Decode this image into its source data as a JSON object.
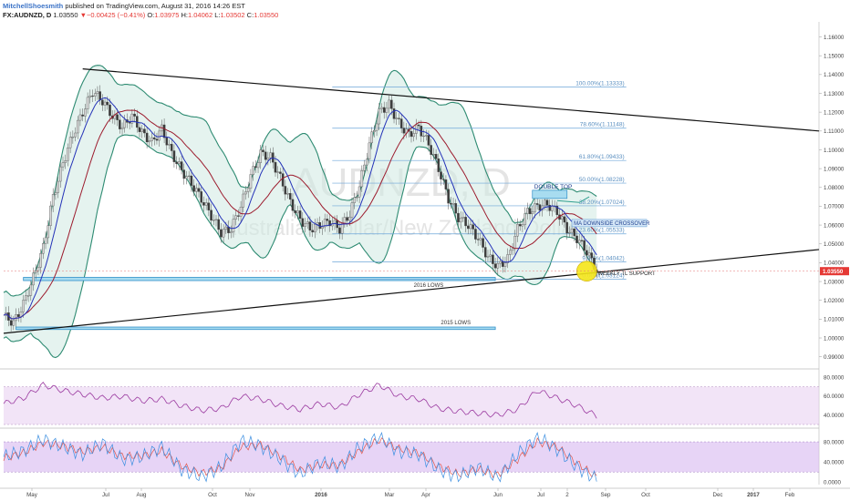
{
  "header": {
    "author": "MitchellShoesmith",
    "published": " published on TradingView.com, August 31, 2016 14:26 EST",
    "symbol": "FX:AUDNZD, D",
    "last": " 1.03550 ",
    "arrow": "▼",
    "change": "−0.00425 (−0.41%)",
    "o_label": " O:",
    "o_val": "1.03975",
    "h_label": " H:",
    "h_val": "1.04062",
    "l_label": " L:",
    "l_val": "1.03502",
    "c_label": " C:",
    "c_val": "1.03550"
  },
  "watermark": {
    "symbol": "AUDNZD, D",
    "name": "Australian Dollar/New Zealand Dollar"
  },
  "colors": {
    "band": "#2e8b72",
    "band_fill": "#cfe9e2",
    "ma_fast": "#2432b8",
    "ma_slow": "#9c1b2d",
    "candle_up": "#d9d9d9",
    "candle_down": "#3a3a3a",
    "fib": "#6ea6d9",
    "rsi": "#9b3aa0",
    "stoch_k": "#3b8ee0",
    "stoch_d": "#e0554a",
    "osc_fill": "#e8cdf0",
    "price_tag": "#e53935"
  },
  "chart_data": [
    {
      "type": "candlestick",
      "title": "FX:AUDNZD, D",
      "x_tick_labels": [
        "May",
        "Jul",
        "Aug",
        "Oct",
        "Nov",
        "2016",
        "Mar",
        "Apr",
        "Jun",
        "Jul",
        "2",
        "Sep",
        "Oct",
        "Dec",
        "2017",
        "Feb"
      ],
      "y_ticks": [
        "1.16000",
        "1.15000",
        "1.14000",
        "1.13000",
        "1.12000",
        "1.11000",
        "1.10000",
        "1.09000",
        "1.08000",
        "1.07000",
        "1.06000",
        "1.05000",
        "1.04000",
        "1.03000",
        "1.02000",
        "1.01000",
        "1.00000",
        "0.99000"
      ],
      "y_range": [
        0.985,
        1.168
      ],
      "last_price": "1.03550",
      "close_path": [
        [
          0,
          1.012
        ],
        [
          4,
          1.008
        ],
        [
          8,
          1.018
        ],
        [
          12,
          1.032
        ],
        [
          16,
          1.048
        ],
        [
          20,
          1.075
        ],
        [
          24,
          1.093
        ],
        [
          28,
          1.108
        ],
        [
          32,
          1.12
        ],
        [
          36,
          1.131
        ],
        [
          40,
          1.126
        ],
        [
          44,
          1.118
        ],
        [
          48,
          1.112
        ],
        [
          52,
          1.118
        ],
        [
          56,
          1.109
        ],
        [
          60,
          1.104
        ],
        [
          64,
          1.111
        ],
        [
          68,
          1.098
        ],
        [
          72,
          1.089
        ],
        [
          76,
          1.082
        ],
        [
          80,
          1.074
        ],
        [
          84,
          1.065
        ],
        [
          88,
          1.056
        ],
        [
          92,
          1.058
        ],
        [
          96,
          1.07
        ],
        [
          100,
          1.086
        ],
        [
          104,
          1.098
        ],
        [
          108,
          1.096
        ],
        [
          112,
          1.085
        ],
        [
          116,
          1.072
        ],
        [
          120,
          1.063
        ],
        [
          124,
          1.058
        ],
        [
          128,
          1.06
        ],
        [
          132,
          1.062
        ],
        [
          136,
          1.058
        ],
        [
          140,
          1.066
        ],
        [
          144,
          1.081
        ],
        [
          148,
          1.103
        ],
        [
          152,
          1.12
        ],
        [
          156,
          1.124
        ],
        [
          160,
          1.114
        ],
        [
          164,
          1.108
        ],
        [
          168,
          1.112
        ],
        [
          172,
          1.103
        ],
        [
          176,
          1.09
        ],
        [
          180,
          1.074
        ],
        [
          184,
          1.064
        ],
        [
          188,
          1.06
        ],
        [
          192,
          1.053
        ],
        [
          196,
          1.043
        ],
        [
          200,
          1.038
        ],
        [
          204,
          1.042
        ],
        [
          208,
          1.058
        ],
        [
          212,
          1.067
        ],
        [
          216,
          1.07
        ],
        [
          220,
          1.071
        ],
        [
          224,
          1.067
        ],
        [
          228,
          1.058
        ],
        [
          232,
          1.053
        ],
        [
          236,
          1.046
        ],
        [
          240,
          1.036
        ]
      ],
      "bollinger_pct": 0.02,
      "indicators": [
        "Bollinger Bands",
        "Moving average (fast)",
        "Moving average (slow)"
      ],
      "fibonacci": [
        {
          "label": "100.00%(1.13333)",
          "level": 1.13333
        },
        {
          "label": "78.60%(1.11148)",
          "level": 1.11148
        },
        {
          "label": "61.80%(1.09433)",
          "level": 1.09433
        },
        {
          "label": "50.00%(1.08228)",
          "level": 1.08228
        },
        {
          "label": "38.20%(1.07024)",
          "level": 1.07024
        },
        {
          "label": "23.60%(1.05533)",
          "level": 1.05533
        },
        {
          "label": "9.00%(1.04042)",
          "level": 1.04042
        },
        {
          "label": "0.00%(1.03124)",
          "level": 1.03124
        }
      ],
      "zones": [
        {
          "label": "2016 LOWS",
          "low": 1.0305,
          "high": 1.0322
        },
        {
          "label": "2015 LOWS",
          "low": 1.0045,
          "high": 1.0058
        }
      ],
      "annotations": [
        "DOUBLE TOP",
        "MA DOWNSIDE CROSSOVER",
        "WEEKLY TL SUPPORT"
      ]
    },
    {
      "type": "line",
      "name": "RSI",
      "y_ticks": [
        "80.0000",
        "60.0000",
        "40.0000"
      ],
      "y_range": [
        30,
        85
      ],
      "bands": [
        70,
        30
      ],
      "values": [
        [
          0,
          52
        ],
        [
          8,
          58
        ],
        [
          16,
          72
        ],
        [
          24,
          66
        ],
        [
          32,
          62
        ],
        [
          40,
          58
        ],
        [
          48,
          60
        ],
        [
          56,
          55
        ],
        [
          64,
          57
        ],
        [
          72,
          50
        ],
        [
          80,
          45
        ],
        [
          88,
          47
        ],
        [
          96,
          60
        ],
        [
          104,
          57
        ],
        [
          112,
          50
        ],
        [
          120,
          46
        ],
        [
          128,
          52
        ],
        [
          136,
          48
        ],
        [
          144,
          62
        ],
        [
          152,
          72
        ],
        [
          160,
          60
        ],
        [
          168,
          57
        ],
        [
          176,
          47
        ],
        [
          184,
          44
        ],
        [
          192,
          42
        ],
        [
          200,
          40
        ],
        [
          208,
          46
        ],
        [
          216,
          66
        ],
        [
          224,
          58
        ],
        [
          232,
          50
        ],
        [
          240,
          39
        ]
      ]
    },
    {
      "type": "line",
      "name": "Stochastic",
      "y_ticks": [
        "80.0000",
        "40.0000",
        "0.0000"
      ],
      "y_range": [
        -5,
        100
      ],
      "bands": [
        80,
        20
      ],
      "k_values": [
        [
          0,
          50
        ],
        [
          8,
          62
        ],
        [
          16,
          85
        ],
        [
          24,
          70
        ],
        [
          32,
          55
        ],
        [
          40,
          78
        ],
        [
          48,
          45
        ],
        [
          56,
          50
        ],
        [
          64,
          70
        ],
        [
          72,
          25
        ],
        [
          80,
          10
        ],
        [
          88,
          30
        ],
        [
          96,
          82
        ],
        [
          104,
          72
        ],
        [
          112,
          45
        ],
        [
          120,
          15
        ],
        [
          128,
          40
        ],
        [
          136,
          30
        ],
        [
          144,
          70
        ],
        [
          152,
          90
        ],
        [
          160,
          60
        ],
        [
          168,
          55
        ],
        [
          176,
          25
        ],
        [
          184,
          10
        ],
        [
          192,
          30
        ],
        [
          200,
          8
        ],
        [
          208,
          55
        ],
        [
          216,
          90
        ],
        [
          224,
          65
        ],
        [
          232,
          30
        ],
        [
          240,
          5
        ]
      ],
      "d_values": [
        [
          0,
          48
        ],
        [
          8,
          58
        ],
        [
          16,
          78
        ],
        [
          24,
          72
        ],
        [
          32,
          60
        ],
        [
          40,
          70
        ],
        [
          48,
          52
        ],
        [
          56,
          52
        ],
        [
          64,
          62
        ],
        [
          72,
          32
        ],
        [
          80,
          18
        ],
        [
          88,
          28
        ],
        [
          96,
          70
        ],
        [
          104,
          74
        ],
        [
          112,
          52
        ],
        [
          120,
          24
        ],
        [
          128,
          34
        ],
        [
          136,
          34
        ],
        [
          144,
          62
        ],
        [
          152,
          84
        ],
        [
          160,
          66
        ],
        [
          168,
          58
        ],
        [
          176,
          32
        ],
        [
          184,
          16
        ],
        [
          192,
          26
        ],
        [
          200,
          14
        ],
        [
          208,
          45
        ],
        [
          216,
          80
        ],
        [
          224,
          70
        ],
        [
          232,
          38
        ],
        [
          240,
          10
        ]
      ]
    }
  ]
}
